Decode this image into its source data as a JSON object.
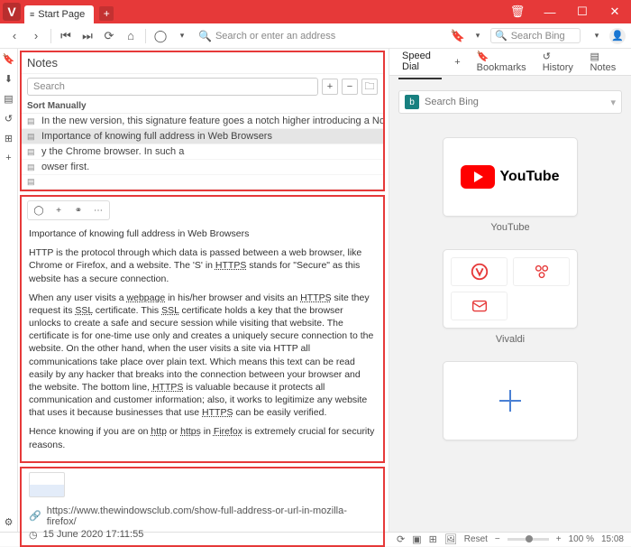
{
  "titlebar": {
    "tab_label": "Start Page"
  },
  "addressbar": {
    "placeholder": "Search or enter an address",
    "search_engine": "Search Bing"
  },
  "notes": {
    "header": "Notes",
    "search_placeholder": "Search",
    "sort_label": "Sort Manually",
    "items": [
      "In the new version, this signature feature goes a notch higher introducing a Notes Manager with a full-blown ...",
      "Importance of knowing full address in Web Browsers",
      "y the Chrome browser. In such a",
      "owser first.",
      ""
    ],
    "selected_index": 1,
    "editor": {
      "title": "Importance of knowing full address in Web Browsers",
      "p1_a": "HTTP is the protocol through which data is passed between a web browser, like Chrome or Firefox, and a website. The 'S' in ",
      "p1_link1": "HTTPS",
      "p1_b": " stands for \"Secure\" as this website has a secure connection.",
      "p2_a": "When any user visits a ",
      "p2_link_webpage": "webpage",
      "p2_b": " in his/her browser and visits an ",
      "p2_link_https1": "HTTPS",
      "p2_c": " site they request its ",
      "p2_link_ssl1": "SSL",
      "p2_d": " certificate. This ",
      "p2_link_ssl2": "SSL",
      "p2_e": " certificate holds a key that the browser unlocks to create a safe and secure session while visiting that website. The certificate is for one-time use only and creates a uniquely secure connection to the website. On the other hand, when the user visits a site via HTTP all communications take place over plain text. Which means this text can be read easily by any hacker that breaks into the connection between your browser and the website. The bottom line, ",
      "p2_link_https2": "HTTPS",
      "p2_f": " is valuable because it protects all communication and customer information; also, it works to legitimize any website that uses it because businesses that use ",
      "p2_link_https3": "HTTPS",
      "p2_g": " can be easily verified.",
      "p3_a": "Hence knowing if you are on ",
      "p3_link_http": "http",
      "p3_b": " or ",
      "p3_link_https": "https",
      "p3_c": " in ",
      "p3_link_firefox": "Firefox",
      "p3_d": " is extremely crucial for security reasons."
    },
    "meta": {
      "url": "https://www.thewindowsclub.com/show-full-address-or-url-in-mozilla-firefox/",
      "timestamp": "15 June 2020 17:11:55"
    }
  },
  "speeddial": {
    "tabs": {
      "speed_dial": "Speed Dial",
      "bookmarks": "Bookmarks",
      "history": "History",
      "notes": "Notes"
    },
    "search_placeholder": "Search Bing",
    "tiles": {
      "youtube": "YouTube",
      "vivaldi": "Vivaldi"
    }
  },
  "status": {
    "reset": "Reset",
    "zoom": "100 %",
    "clock": "15:08"
  }
}
